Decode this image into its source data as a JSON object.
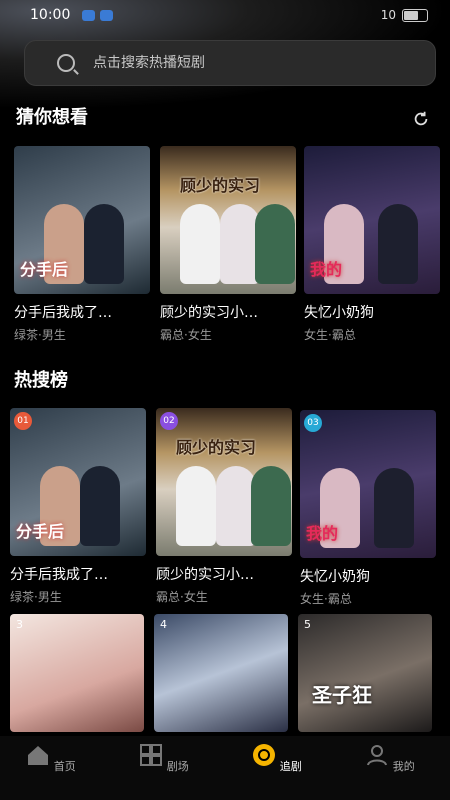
{
  "status": {
    "time": "10:00",
    "right": "10"
  },
  "search": {
    "placeholder": "点击搜索热播短剧"
  },
  "sections": {
    "guess": "猜你想看",
    "hot": "热搜榜"
  },
  "guess": [
    {
      "title": "分手后我成了…",
      "tags": "绿茶·男生",
      "poster": "分手后"
    },
    {
      "title": "顾少的实习小…",
      "tags": "霸总·女生",
      "poster": "顾少的实习"
    },
    {
      "title": "失忆小奶狗",
      "tags": "女生·霸总",
      "poster": "我的"
    }
  ],
  "hot": [
    {
      "rank": "01",
      "title": "分手后我成了…",
      "tags": "绿茶·男生",
      "poster": "分手后",
      "color": "#e85a3a"
    },
    {
      "rank": "02",
      "title": "顾少的实习小…",
      "tags": "霸总·女生",
      "poster": "顾少的实习",
      "color": "#8a4fe0"
    },
    {
      "rank": "03",
      "title": "失忆小奶狗",
      "tags": "女生·霸总",
      "poster": "我的",
      "color": "#27a9d6"
    }
  ],
  "more": [
    {
      "rank": "3"
    },
    {
      "rank": "4"
    },
    {
      "rank": "5",
      "poster": "圣子狂"
    }
  ],
  "tabs": [
    {
      "label": "首页"
    },
    {
      "label": "剧场"
    },
    {
      "label": "追剧"
    },
    {
      "label": "我的"
    }
  ]
}
